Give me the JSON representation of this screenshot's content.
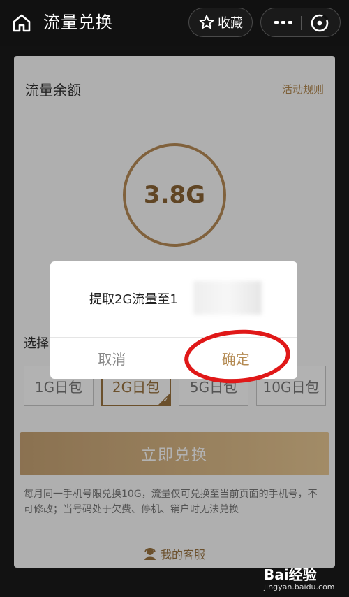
{
  "topbar": {
    "title": "流量兑换",
    "favorite_label": "收藏"
  },
  "balance": {
    "label": "流量余额",
    "rules_link": "活动规则",
    "amount": "3.8G"
  },
  "packages": {
    "label": "选择",
    "items": [
      {
        "label": "1G日包",
        "selected": false
      },
      {
        "label": "2G日包",
        "selected": true
      },
      {
        "label": "5G日包",
        "selected": false
      },
      {
        "label": "10G日包",
        "selected": false
      }
    ]
  },
  "exchange_button": "立即兑换",
  "notice": "每月同一手机号限兑换10G，流量仅可兑换至当前页面的手机号，不可修改；当号码处于欠费、停机、销户时无法兑换",
  "service_label": "我的客服",
  "dialog": {
    "message": "提取2G流量至1",
    "cancel": "取消",
    "confirm": "确定"
  },
  "watermark": {
    "brand": "Bai经验",
    "url": "jingyan.baidu.com"
  },
  "colors": {
    "accent": "#b48a52",
    "annotation": "#e01818",
    "topbar_bg": "#111111"
  }
}
